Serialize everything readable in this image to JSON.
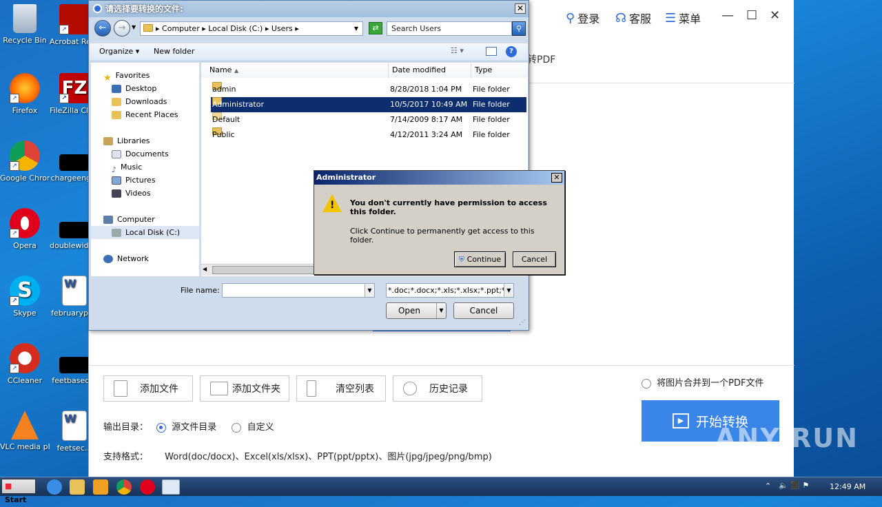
{
  "desktop": {
    "icons": [
      {
        "label": "Recycle Bin"
      },
      {
        "label": "Acrobat Reader DC"
      },
      {
        "label": "Firefox"
      },
      {
        "label": "FileZilla Client"
      },
      {
        "label": "Google Chrome"
      },
      {
        "label": "chargeeng..."
      },
      {
        "label": "Opera"
      },
      {
        "label": "doublewide..."
      },
      {
        "label": "Skype"
      },
      {
        "label": "februarypr..."
      },
      {
        "label": "CCleaner"
      },
      {
        "label": "feetbased..."
      },
      {
        "label": "VLC media player"
      },
      {
        "label": "feetsec..."
      }
    ]
  },
  "app": {
    "login": "登录",
    "service": "客服",
    "menu": "菜单",
    "header_fragment": "转PDF",
    "buttons": {
      "add_file": "添加文件",
      "add_folder": "添加文件夹",
      "clear_list": "清空列表",
      "history": "历史记录"
    },
    "merge_option": "将图片合并到一个PDF文件",
    "start_button": "开始转换",
    "output_label": "输出目录：",
    "output_source": "源文件目录",
    "output_custom": "自定义",
    "formats_label": "支持格式：",
    "formats_value": "Word(doc/docx)、Excel(xls/xlsx)、PPT(ppt/pptx)、图片(jpg/jpeg/png/bmp)"
  },
  "file_dialog": {
    "title": "请选择要转换的文件:",
    "breadcrumb": [
      "Computer",
      "Local Disk (C:)",
      "Users"
    ],
    "search_placeholder": "Search Users",
    "organize": "Organize",
    "new_folder": "New folder",
    "nav": {
      "favorites": "Favorites",
      "desktop": "Desktop",
      "downloads": "Downloads",
      "recent": "Recent Places",
      "libraries": "Libraries",
      "documents": "Documents",
      "music": "Music",
      "pictures": "Pictures",
      "videos": "Videos",
      "computer": "Computer",
      "local_disk": "Local Disk (C:)",
      "network": "Network"
    },
    "columns": {
      "name": "Name",
      "date": "Date modified",
      "type": "Type"
    },
    "files": [
      {
        "name": "admin",
        "date": "8/28/2018 1:04 PM",
        "type": "File folder"
      },
      {
        "name": "Administrator",
        "date": "10/5/2017 10:49 AM",
        "type": "File folder"
      },
      {
        "name": "Default",
        "date": "7/14/2009 8:17 AM",
        "type": "File folder"
      },
      {
        "name": "Public",
        "date": "4/12/2011 3:24 AM",
        "type": "File folder"
      }
    ],
    "file_name_label": "File name:",
    "file_name_value": "",
    "filter": "*.doc;*.docx;*.xls;*.xlsx;*.ppt;*.p",
    "open": "Open",
    "cancel": "Cancel"
  },
  "alert": {
    "title": "Administrator",
    "heading": "You don't currently have permission to access this folder.",
    "body": "Click Continue to permanently get access to this folder.",
    "continue": "Continue",
    "cancel": "Cancel"
  },
  "taskbar": {
    "start": "Start",
    "time": "12:49 AM"
  },
  "watermark": "ANY RUN"
}
